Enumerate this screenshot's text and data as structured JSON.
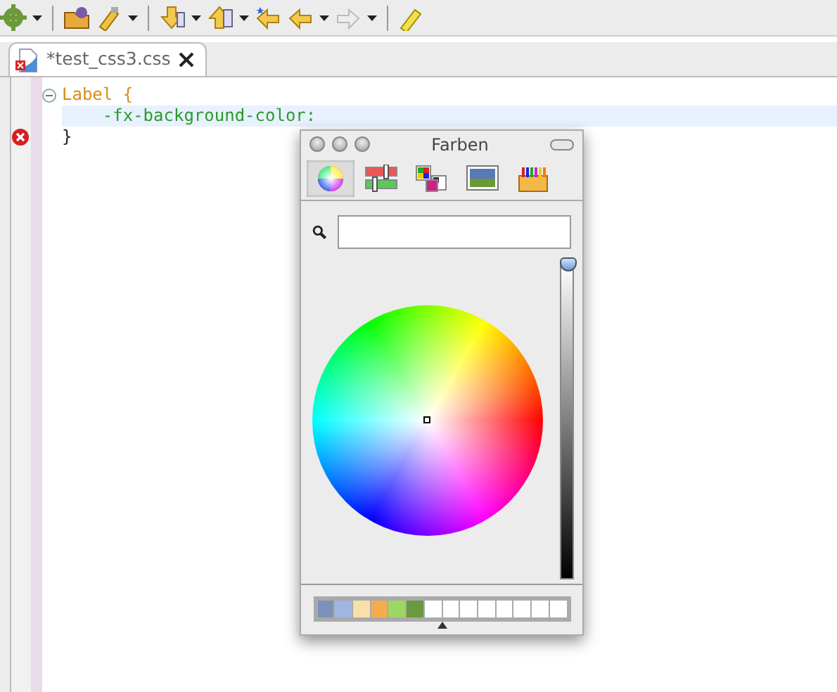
{
  "editor_tab": {
    "title": "*test_css3.css",
    "dirty_error": true
  },
  "code_lines": [
    {
      "text": "Label {",
      "kind": "selector",
      "current": false,
      "error": false,
      "fold": true
    },
    {
      "text": "    -fx-background-color:",
      "kind": "property",
      "current": true,
      "error": false,
      "fold": false
    },
    {
      "text": "}",
      "kind": "brace",
      "current": false,
      "error": true,
      "fold": false
    }
  ],
  "color_panel": {
    "title": "Farben",
    "modes": [
      {
        "selected": true
      },
      {
        "selected": false
      },
      {
        "selected": false
      },
      {
        "selected": false
      },
      {
        "selected": false
      }
    ],
    "brightness": {
      "level": 1.0
    },
    "swatches": [
      {
        "kind": "color",
        "color": "#7b93b8"
      },
      {
        "kind": "color",
        "color": "#9fb6e0"
      },
      {
        "kind": "color",
        "color": "#f8e0a8"
      },
      {
        "kind": "color",
        "color": "#f4ad4c"
      },
      {
        "kind": "color",
        "color": "#9cd764"
      },
      {
        "kind": "color",
        "color": "#6b9a3e"
      },
      {
        "kind": "empty"
      },
      {
        "kind": "empty"
      },
      {
        "kind": "empty"
      },
      {
        "kind": "empty"
      },
      {
        "kind": "empty"
      },
      {
        "kind": "empty"
      },
      {
        "kind": "empty"
      },
      {
        "kind": "empty"
      }
    ]
  }
}
